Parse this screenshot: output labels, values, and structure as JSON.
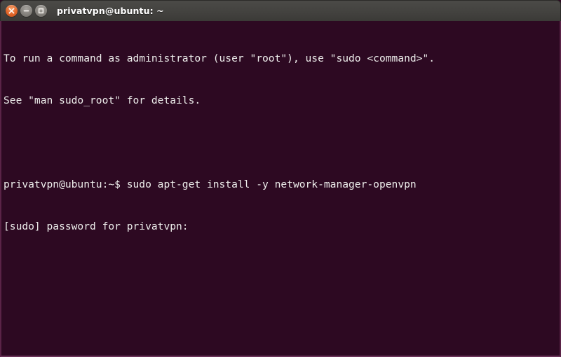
{
  "window": {
    "title": "privatvpn@ubuntu: ~",
    "controls": [
      {
        "name": "close-button",
        "icon": "close-icon",
        "label": "Close"
      },
      {
        "name": "minimize-button",
        "icon": "minimize-icon",
        "label": "Minimize"
      },
      {
        "name": "maximize-button",
        "icon": "maximize-icon",
        "label": "Maximize"
      }
    ],
    "colors": {
      "titlebar": "#444340",
      "terminal_background": "#2d0922",
      "terminal_foreground": "#eeeeec",
      "close_button": "#e2672a",
      "other_buttons": "#86837e",
      "window_border": "#5a2347"
    }
  },
  "terminal": {
    "lines": [
      "To run a command as administrator (user \"root\"), use \"sudo <command>\".",
      "See \"man sudo_root\" for details.",
      "",
      "privatvpn@ubuntu:~$ sudo apt-get install -y network-manager-openvpn",
      "[sudo] password for privatvpn:"
    ]
  }
}
